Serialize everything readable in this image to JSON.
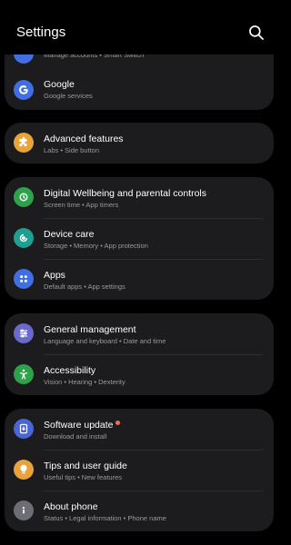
{
  "header": {
    "title": "Settings",
    "search_icon": "search-icon"
  },
  "accounts_partial": {
    "sub": "Manage accounts  •  Smart Switch",
    "icon": "accounts-icon",
    "color": "#3f6fe0"
  },
  "google": {
    "label": "Google",
    "sub": "Google services",
    "icon": "google-icon",
    "color": "#3f6fe0"
  },
  "advanced": {
    "label": "Advanced features",
    "sub": "Labs  •  Side button",
    "icon": "puzzle-icon",
    "color": "#e8a33a"
  },
  "wellbeing": {
    "label": "Digital Wellbeing and parental controls",
    "sub": "Screen time  •  App timers",
    "icon": "wellbeing-icon",
    "color": "#2ea24b"
  },
  "device_care": {
    "label": "Device care",
    "sub": "Storage  •  Memory  •  App protection",
    "icon": "device-care-icon",
    "color": "#1e9f8f"
  },
  "apps": {
    "label": "Apps",
    "sub": "Default apps  •  App settings",
    "icon": "apps-icon",
    "color": "#3f6fe0"
  },
  "general": {
    "label": "General management",
    "sub": "Language and keyboard  •  Date and time",
    "icon": "sliders-icon",
    "color": "#6a6acb"
  },
  "accessibility": {
    "label": "Accessibility",
    "sub": "Vision  •  Hearing  •  Dexterity",
    "icon": "accessibility-icon",
    "color": "#2ea24b"
  },
  "software_update": {
    "label": "Software update",
    "sub": "Download and install",
    "icon": "update-icon",
    "color": "#4a66d6",
    "badge_color": "#ff6b3d"
  },
  "tips": {
    "label": "Tips and user guide",
    "sub": "Useful tips  •  New features",
    "icon": "bulb-icon",
    "color": "#e8a33a"
  },
  "about": {
    "label": "About phone",
    "sub": "Status  •  Legal information  •  Phone name",
    "icon": "info-icon",
    "color": "#6d6d76"
  }
}
